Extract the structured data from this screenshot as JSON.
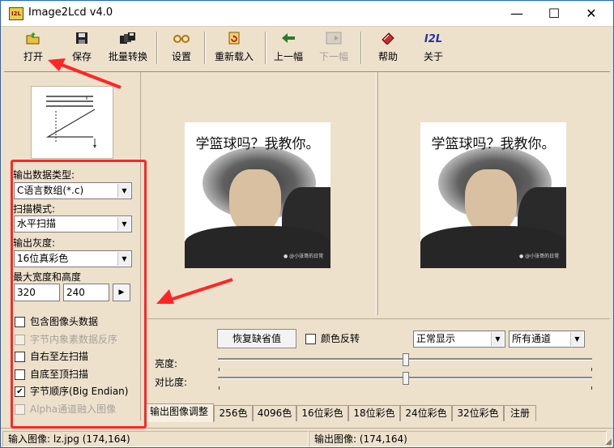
{
  "window": {
    "title": "Image2Lcd v4.0",
    "icon_text": "I2L",
    "controls": {
      "minimize": "—",
      "maximize": "☐",
      "close": "✕"
    }
  },
  "toolbar": {
    "items": [
      {
        "label": "打开",
        "icon": "open-folder-icon",
        "enabled": true
      },
      {
        "label": "保存",
        "icon": "save-disk-icon",
        "enabled": true
      },
      {
        "label": "批量转换",
        "icon": "batch-convert-icon",
        "enabled": true
      },
      {
        "label": "设置",
        "icon": "settings-glasses-icon",
        "enabled": true
      },
      {
        "label": "重新载入",
        "icon": "reload-icon",
        "enabled": true
      },
      {
        "label": "上一幅",
        "icon": "previous-arrow-icon",
        "enabled": true
      },
      {
        "label": "下一幅",
        "icon": "next-arrow-icon",
        "enabled": false
      },
      {
        "label": "帮助",
        "icon": "help-book-icon",
        "enabled": true
      },
      {
        "label": "关于",
        "icon": "about-i2l-icon",
        "enabled": true
      }
    ],
    "about_icon_text": "I2L"
  },
  "settings": {
    "output_type_label": "输出数据类型:",
    "output_type_value": "C语言数组(*.c)",
    "scan_mode_label": "扫描模式:",
    "scan_mode_value": "水平扫描",
    "gray_label": "输出灰度:",
    "gray_value": "16位真彩色",
    "size_label": "最大宽度和高度",
    "max_width": "320",
    "max_height": "240",
    "size_button": "▶",
    "options": [
      {
        "label": "包含图像头数据",
        "checked": false,
        "enabled": true
      },
      {
        "label": "字节内象素数据反序",
        "checked": false,
        "enabled": false
      },
      {
        "label": "自右至左扫描",
        "checked": false,
        "enabled": true
      },
      {
        "label": "自底至顶扫描",
        "checked": false,
        "enabled": true
      },
      {
        "label": "字节顺序(Big Endian)",
        "checked": true,
        "enabled": true
      },
      {
        "label": "Alpha通道融入图像",
        "checked": false,
        "enabled": false
      }
    ]
  },
  "images": {
    "input_caption": "学篮球吗？我教你。",
    "output_caption": "学篮球吗？我教你。",
    "watermark": "● @小张哥的日常"
  },
  "adjust": {
    "restore_button": "恢复缺省值",
    "invert_label": "颜色反转",
    "invert_checked": false,
    "display_mode": "正常显示",
    "channel": "所有通道",
    "brightness_label": "亮度:",
    "contrast_label": "对比度:",
    "brightness_level": 0.5,
    "contrast_level": 0.5
  },
  "tabs": [
    {
      "label": "输出图像调整",
      "active": true
    },
    {
      "label": "256色",
      "active": false
    },
    {
      "label": "4096色",
      "active": false
    },
    {
      "label": "16位彩色",
      "active": false
    },
    {
      "label": "18位彩色",
      "active": false
    },
    {
      "label": "24位彩色",
      "active": false
    },
    {
      "label": "32位彩色",
      "active": false
    },
    {
      "label": "注册",
      "active": false
    }
  ],
  "status": {
    "input": "输入图像: lz.jpg (174,164)",
    "output": "输出图像: (174,164)"
  },
  "colors": {
    "highlight": "#ff2626",
    "background": "#ede1cc"
  }
}
